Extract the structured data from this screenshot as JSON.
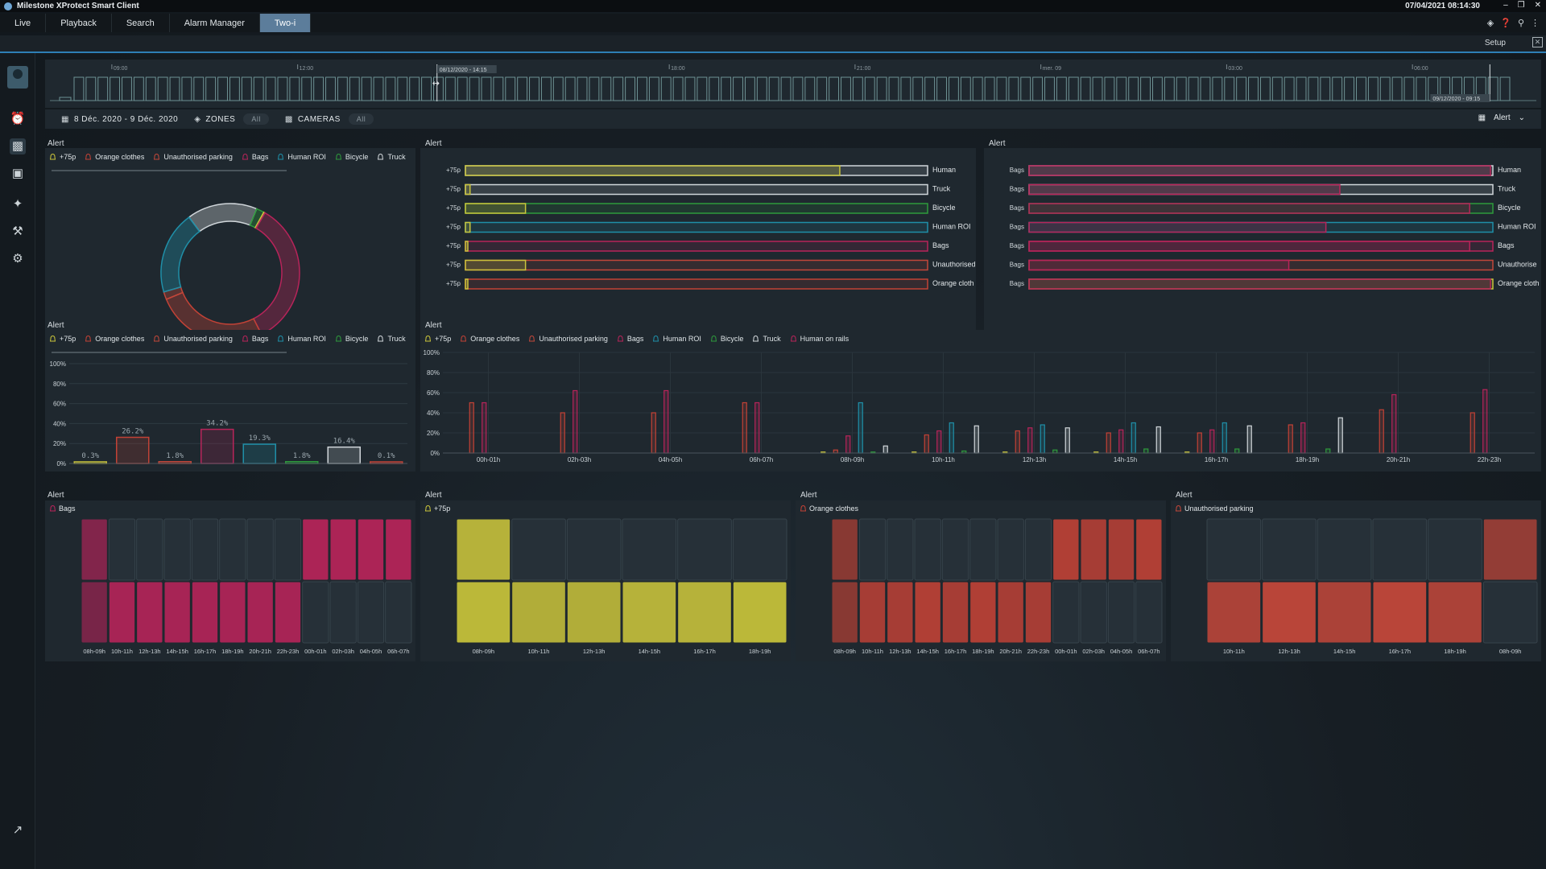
{
  "window": {
    "title": "Milestone XProtect Smart Client",
    "datetime": "07/04/2021 08:14:30"
  },
  "menu": {
    "tabs": [
      {
        "label": "Live"
      },
      {
        "label": "Playback"
      },
      {
        "label": "Search"
      },
      {
        "label": "Alarm Manager"
      },
      {
        "label": "Two-i",
        "active": true
      }
    ],
    "setup_label": "Setup"
  },
  "timeline": {
    "labels": [
      "09:00",
      "12:00",
      "18:00",
      "21:00",
      "mer. 09",
      "03:00",
      "06:00"
    ],
    "label_hours": [
      9,
      12,
      18,
      21,
      24,
      27,
      30
    ],
    "start_hour": 8,
    "end_hour": 32,
    "selection_start": "08/12/2020 - 14:15",
    "selection_end": "09/12/2020 - 09:15"
  },
  "filters": {
    "date_range": "8 Déc. 2020 - 9 Déc. 2020",
    "zones_label": "ZONES",
    "zones_value": "All",
    "cameras_label": "CAMERAS",
    "cameras_value": "All",
    "alert_select": "Alert"
  },
  "colors": {
    "p75": "#c9c43b",
    "orange": "#c24236",
    "unauth": "#c2473a",
    "bags": "#b8245a",
    "human_roi": "#1f8fa8",
    "bicycle": "#2e9a3c",
    "truck": "#d0d6da",
    "human": "#d0d6da",
    "human_rails": "#b8245a"
  },
  "legend_items": [
    {
      "label": "+75p",
      "color": "#c9c43b"
    },
    {
      "label": "Orange clothes",
      "color": "#c24236"
    },
    {
      "label": "Unauthorised parking",
      "color": "#c2473a"
    },
    {
      "label": "Bags",
      "color": "#b8245a"
    },
    {
      "label": "Human ROI",
      "color": "#1f8fa8"
    },
    {
      "label": "Bicycle",
      "color": "#2e9a3c"
    },
    {
      "label": "Truck",
      "color": "#d0d6da"
    }
  ],
  "legend_items_wide": [
    {
      "label": "+75p",
      "color": "#c9c43b"
    },
    {
      "label": "Orange clothes",
      "color": "#c24236"
    },
    {
      "label": "Unauthorised parking",
      "color": "#c2473a"
    },
    {
      "label": "Bags",
      "color": "#b8245a"
    },
    {
      "label": "Human ROI",
      "color": "#1f8fa8"
    },
    {
      "label": "Bicycle",
      "color": "#2e9a3c"
    },
    {
      "label": "Truck",
      "color": "#d0d6da"
    },
    {
      "label": "Human on rails",
      "color": "#b8245a"
    }
  ],
  "panel_titles": {
    "donut": "Alert",
    "hbars1": "Alert",
    "hbars2": "Alert",
    "bars": "Alert",
    "hourly": "Alert",
    "heat1": "Alert",
    "heat2": "Alert",
    "heat3": "Alert",
    "heat4": "Alert"
  },
  "chart_data": [
    {
      "type": "pie",
      "variant": "donut",
      "labels": [
        "+75p",
        "Orange clothes",
        "Unauthorised parking",
        "Bags",
        "Human ROI",
        "Bicycle",
        "Truck"
      ],
      "values": [
        0.3,
        26.2,
        1.8,
        34.2,
        19.3,
        1.8,
        16.4
      ],
      "colors": [
        "#c9c43b",
        "#c24236",
        "#c2473a",
        "#b8245a",
        "#1f8fa8",
        "#2e9a3c",
        "#d0d6da"
      ]
    },
    {
      "type": "bar",
      "orientation": "horizontal",
      "left_labels": [
        "+75p",
        "+75p",
        "+75p",
        "+75p",
        "+75p",
        "+75p",
        "+75p"
      ],
      "right_labels": [
        "Human",
        "Truck",
        "Bicycle",
        "Human ROI",
        "Bags",
        "Unauthorised",
        "Orange cloth"
      ],
      "right_colors": [
        "#d0d6da",
        "#d0d6da",
        "#2e9a3c",
        "#1f8fa8",
        "#b8245a",
        "#c2473a",
        "#c24236"
      ],
      "left_color": "#c9c43b",
      "values": [
        0.81,
        0.01,
        0.13,
        0.01,
        0.0,
        0.13,
        0.0
      ]
    },
    {
      "type": "bar",
      "orientation": "horizontal",
      "left_labels": [
        "Bags",
        "Bags",
        "Bags",
        "Bags",
        "Bags",
        "Bags",
        "Bags"
      ],
      "right_labels": [
        "Human",
        "Truck",
        "Bicycle",
        "Human ROI",
        "Bags",
        "Unauthorise",
        "Orange cloth"
      ],
      "right_colors": [
        "#d0d6da",
        "#d0d6da",
        "#2e9a3c",
        "#1f8fa8",
        "#b8245a",
        "#c2473a",
        "#c9c43b"
      ],
      "left_color": "#b8245a",
      "values": [
        0.995,
        0.67,
        0.95,
        0.64,
        0.95,
        0.56,
        0.995
      ]
    },
    {
      "type": "bar",
      "categories": [
        "+75p",
        "Orange clothes",
        "Unauthorised parking",
        "Bags",
        "Human ROI",
        "Bicycle",
        "Truck",
        "Human"
      ],
      "values": [
        0.3,
        26.2,
        1.8,
        34.2,
        19.3,
        1.8,
        16.4,
        0.1
      ],
      "value_labels": [
        "0.3%",
        "26.2%",
        "1.8%",
        "34.2%",
        "19.3%",
        "1.8%",
        "16.4%",
        "0.1%"
      ],
      "colors": [
        "#c9c43b",
        "#c24236",
        "#c2473a",
        "#b8245a",
        "#1f8fa8",
        "#2e9a3c",
        "#d0d6da",
        "#c24236"
      ],
      "yticks": [
        "100%",
        "80%",
        "60%",
        "40%",
        "20%",
        "0%"
      ],
      "ylim": [
        0,
        100
      ]
    },
    {
      "type": "bar",
      "categories": [
        "00h-01h",
        "02h-03h",
        "04h-05h",
        "06h-07h",
        "08h-09h",
        "10h-11h",
        "12h-13h",
        "14h-15h",
        "16h-17h",
        "18h-19h",
        "20h-21h",
        "22h-23h"
      ],
      "yticks": [
        "100%",
        "80%",
        "60%",
        "40%",
        "20%",
        "0%"
      ],
      "ylim": [
        0,
        100
      ],
      "series": [
        {
          "name": "+75p",
          "color": "#c9c43b",
          "values": [
            0,
            0,
            0,
            0,
            1,
            1,
            1,
            1,
            1,
            0,
            0,
            0
          ]
        },
        {
          "name": "Orange clothes",
          "color": "#c24236",
          "values": [
            50,
            40,
            40,
            50,
            3,
            18,
            22,
            20,
            20,
            28,
            43,
            40
          ]
        },
        {
          "name": "Bags",
          "color": "#b8245a",
          "values": [
            50,
            62,
            62,
            50,
            17,
            22,
            25,
            23,
            23,
            30,
            58,
            63
          ]
        },
        {
          "name": "Human ROI",
          "color": "#1f8fa8",
          "values": [
            0,
            0,
            0,
            0,
            50,
            30,
            28,
            30,
            30,
            0,
            0,
            0
          ]
        },
        {
          "name": "Bicycle",
          "color": "#2e9a3c",
          "values": [
            0,
            0,
            0,
            0,
            1,
            2,
            3,
            4,
            4,
            4,
            0,
            0
          ]
        },
        {
          "name": "Truck",
          "color": "#d0d6da",
          "values": [
            0,
            0,
            0,
            0,
            7,
            27,
            25,
            26,
            27,
            35,
            0,
            0
          ]
        }
      ]
    },
    {
      "type": "heatmap",
      "legend": "Bags",
      "color": "#b8245a",
      "categories": [
        "08h-09h",
        "10h-11h",
        "12h-13h",
        "14h-15h",
        "16h-17h",
        "18h-19h",
        "20h-21h",
        "22h-23h",
        "00h-01h",
        "02h-03h",
        "04h-05h",
        "06h-07h"
      ],
      "rows": [
        [
          0.5,
          0,
          0,
          0,
          0,
          0,
          0,
          0,
          0.95,
          0.95,
          0.95,
          0.95
        ],
        [
          0.4,
          0.9,
          0.9,
          0.9,
          0.9,
          0.9,
          0.9,
          0.9,
          0,
          0,
          0,
          0
        ]
      ]
    },
    {
      "type": "heatmap",
      "legend": "+75p",
      "color": "#c9c43b",
      "categories": [
        "08h-09h",
        "10h-11h",
        "12h-13h",
        "14h-15h",
        "16h-17h",
        "18h-19h"
      ],
      "rows": [
        [
          0.9,
          0,
          0,
          0,
          0,
          0
        ],
        [
          0.95,
          0.85,
          0.85,
          0.9,
          0.9,
          0.95
        ]
      ]
    },
    {
      "type": "heatmap",
      "legend": "Orange clothes",
      "color": "#c24236",
      "categories": [
        "08h-09h",
        "10h-11h",
        "12h-13h",
        "14h-15h",
        "16h-17h",
        "18h-19h",
        "20h-21h",
        "22h-23h",
        "00h-01h",
        "02h-03h",
        "04h-05h",
        "06h-07h"
      ],
      "rows": [
        [
          0.5,
          0,
          0,
          0,
          0,
          0,
          0,
          0,
          0.9,
          0.8,
          0.8,
          0.9
        ],
        [
          0.5,
          0.8,
          0.8,
          0.9,
          0.8,
          0.9,
          0.8,
          0.8,
          0,
          0,
          0,
          0
        ]
      ]
    },
    {
      "type": "heatmap",
      "legend": "Unauthorised parking",
      "color": "#c2473a",
      "categories": [
        "10h-11h",
        "12h-13h",
        "14h-15h",
        "16h-17h",
        "18h-19h",
        "08h-09h"
      ],
      "rows": [
        [
          0,
          0,
          0,
          0,
          0,
          0.6
        ],
        [
          0.85,
          1.0,
          0.85,
          1.0,
          0.85,
          0
        ]
      ]
    }
  ]
}
